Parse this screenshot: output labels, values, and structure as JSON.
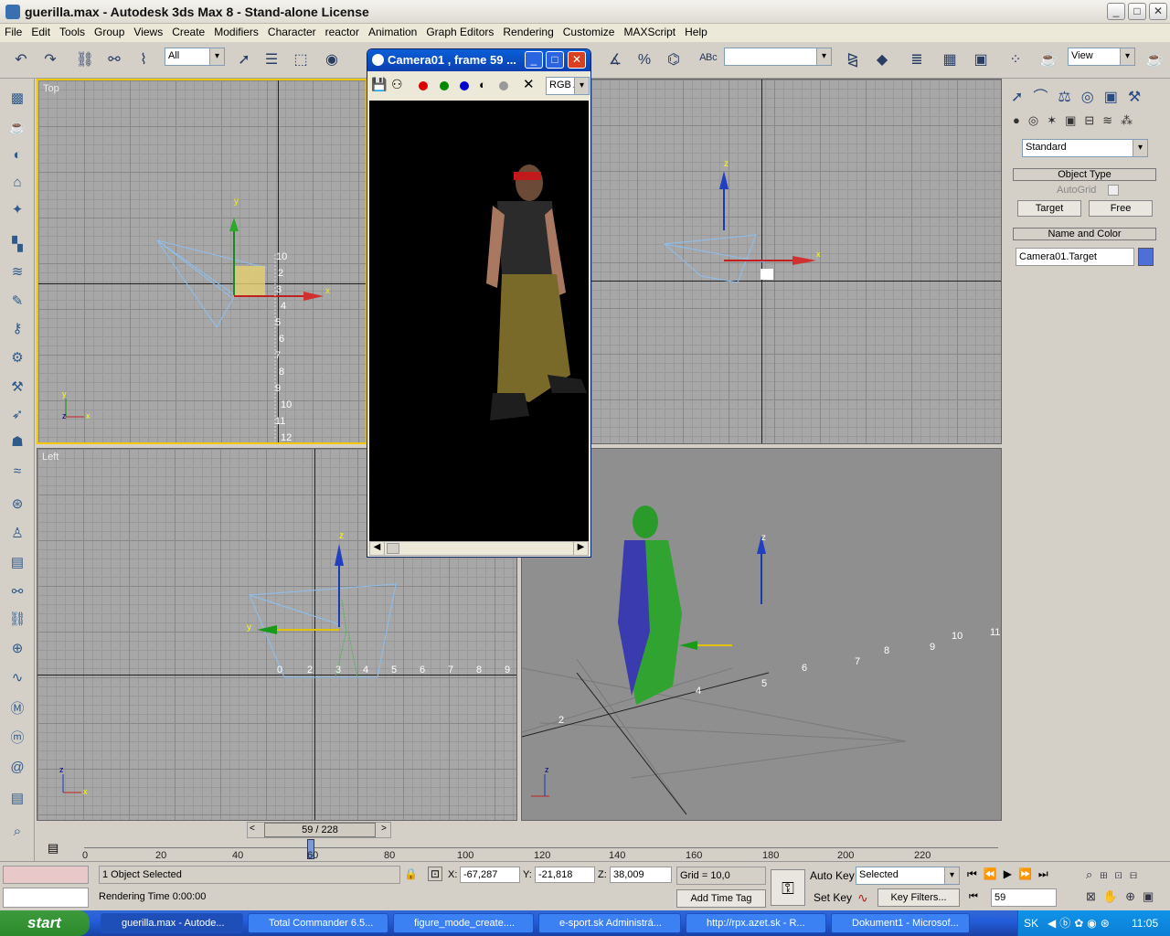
{
  "window": {
    "title": "guerilla.max - Autodesk 3ds Max 8 - Stand-alone License",
    "minimize": "_",
    "maximize": "□",
    "close": "✕"
  },
  "menu": [
    "File",
    "Edit",
    "Tools",
    "Group",
    "Views",
    "Create",
    "Modifiers",
    "Character",
    "reactor",
    "Animation",
    "Graph Editors",
    "Rendering",
    "Customize",
    "MAXScript",
    "Help"
  ],
  "toolbar": {
    "selection_filter": "All",
    "ref_coord": "View"
  },
  "viewports": {
    "top": "Top",
    "left": "Left"
  },
  "camera_window": {
    "title": "Camera01 , frame 59 ...",
    "channel": "RGB Alp"
  },
  "command_panel": {
    "category": "Standard",
    "object_type_header": "Object Type",
    "autogrid_label": "AutoGrid",
    "target_button": "Target",
    "free_button": "Free",
    "name_color_header": "Name and Color",
    "object_name": "Camera01.Target",
    "object_color": "#4f6ed8"
  },
  "timeline": {
    "slider_label": "59 / 228",
    "ticks": [
      "0",
      "20",
      "40",
      "60",
      "80",
      "100",
      "120",
      "140",
      "160",
      "180",
      "200",
      "220"
    ]
  },
  "status": {
    "selection": "1 Object Selected",
    "prompt": "Rendering Time  0:00:00",
    "x_label": "X:",
    "x": "-67,287",
    "y_label": "Y:",
    "y": "-21,818",
    "z_label": "Z:",
    "z": "38,009",
    "grid": "Grid = 10,0",
    "add_time_tag": "Add Time Tag",
    "auto_key": "Auto Key",
    "set_key": "Set Key",
    "key_mode": "Selected",
    "key_filters": "Key Filters...",
    "frame": "59"
  },
  "taskbar": {
    "start": "start",
    "items": [
      "guerilla.max - Autode...",
      "Total Commander 6.5...",
      "figure_mode_create....",
      "e-sport.sk Administrá...",
      "http://rpx.azet.sk - R...",
      "Dokument1 - Microsof..."
    ],
    "lang": "SK",
    "clock": "11:05"
  },
  "colors": {
    "accent": "#0a246a",
    "selection_yellow": "#f0c800",
    "grid": "#a7a7a7"
  }
}
